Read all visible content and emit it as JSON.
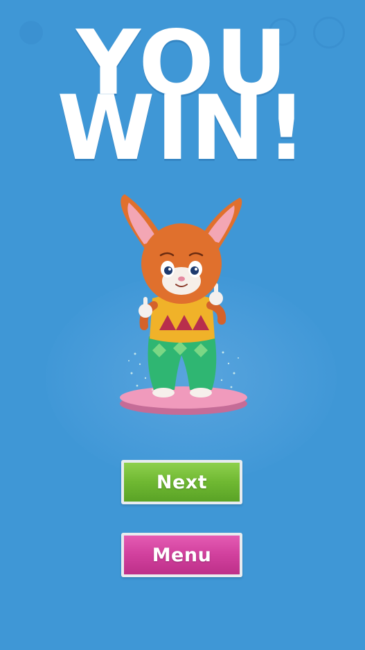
{
  "title": {
    "line1": "YOU",
    "line2": "WIN!"
  },
  "buttons": {
    "next_label": "Next",
    "menu_label": "Menu"
  },
  "colors": {
    "background": "#3f97d6",
    "next_button": "#6fb832",
    "menu_button": "#d1409d"
  },
  "icons": {
    "character": "cartoon-fox-character-icon",
    "pedestal": "pink-pedestal-icon",
    "back": "back-icon",
    "hint": "hint-icon",
    "pause": "pause-icon"
  }
}
